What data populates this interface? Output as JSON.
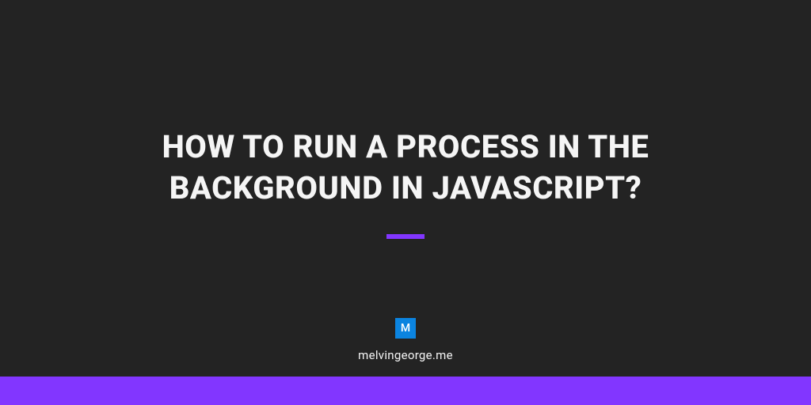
{
  "title": "HOW TO RUN A PROCESS IN THE BACKGROUND IN JAVASCRIPT?",
  "logo": {
    "letter": "M"
  },
  "site_name": "melvingeorge.me",
  "colors": {
    "background": "#232323",
    "accent": "#8236ff",
    "logo": "#0b84e0",
    "text": "#f5f5f5"
  }
}
